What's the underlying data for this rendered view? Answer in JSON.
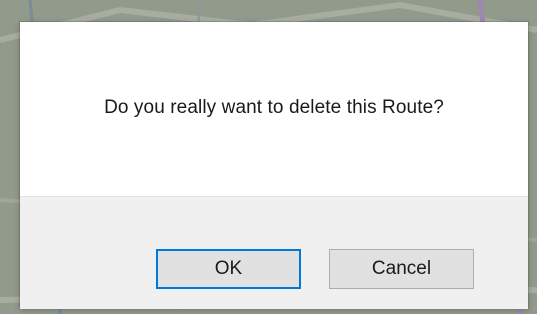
{
  "dialog": {
    "message": "Do you really want to delete this Route?",
    "ok_label": "OK",
    "cancel_label": "Cancel"
  },
  "colors": {
    "dialog_background": "#ffffff",
    "footer_background": "#f0f0f0",
    "button_background": "#e1e1e1",
    "default_button_border": "#0078d7"
  }
}
